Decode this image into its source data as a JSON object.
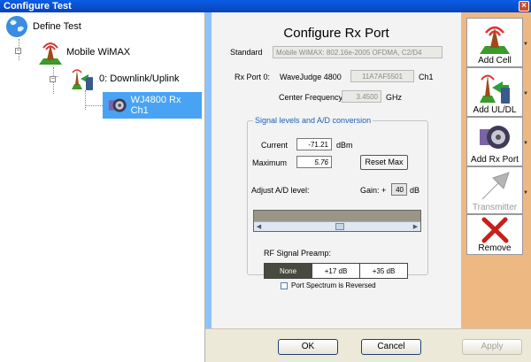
{
  "window": {
    "title": "Configure Test",
    "close_icon": "×"
  },
  "tree": {
    "items": [
      {
        "label": "Define Test",
        "icon": "globe-icon"
      },
      {
        "label": "Mobile WiMAX",
        "icon": "cell-tower-icon"
      },
      {
        "label": "0: Downlink/Uplink",
        "icon": "uldl-icon"
      },
      {
        "label": "WJ4800 Rx Ch1",
        "icon": "rx-port-icon"
      }
    ],
    "expander_minus": "−"
  },
  "panel": {
    "title": "Configure Rx Port",
    "standard_label": "Standard",
    "standard_value": "Mobile WiMAX: 802.16e-2005 OFDMA, C2/D4",
    "rx_port_label": "Rx Port 0:",
    "wavejudge_label": "WaveJudge 4800",
    "serial_value": "11A7AF5501",
    "channel_label": "Ch1",
    "center_freq_label": "Center Frequency",
    "center_freq_value": "3.4500",
    "center_freq_unit": "GHz",
    "group_title": "Signal levels and A/D conversion",
    "current_label": "Current",
    "current_value": "-71.21",
    "current_unit": "dBm",
    "maximum_label": "Maximum",
    "maximum_value": "5.76",
    "reset_max_label": "Reset Max",
    "adjust_label": "Adjust A/D level:",
    "gain_label": "Gain: +",
    "gain_value": "40",
    "gain_unit": "dB",
    "slider_position": 0.52,
    "preamp_label": "RF Signal Preamp:",
    "preamp_options": [
      "None",
      "+17 dB",
      "+35 dB"
    ],
    "preamp_selected": "None",
    "spectrum_reversed_label": "Port Spectrum is Reversed",
    "spectrum_reversed_checked": false
  },
  "toolbar": {
    "add_cell": "Add Cell",
    "add_uldl": "Add UL/DL",
    "add_rx_port": "Add Rx Port",
    "transmitter": "Transmitter",
    "remove": "Remove",
    "dropdown_glyph": "▼"
  },
  "footer": {
    "ok": "OK",
    "cancel": "Cancel",
    "apply": "Apply"
  },
  "colors": {
    "selection": "#48a3f5",
    "splitter": "#8cc3ff",
    "toolbar_bg": "#eeb883",
    "group_title": "#1f5fb8"
  }
}
